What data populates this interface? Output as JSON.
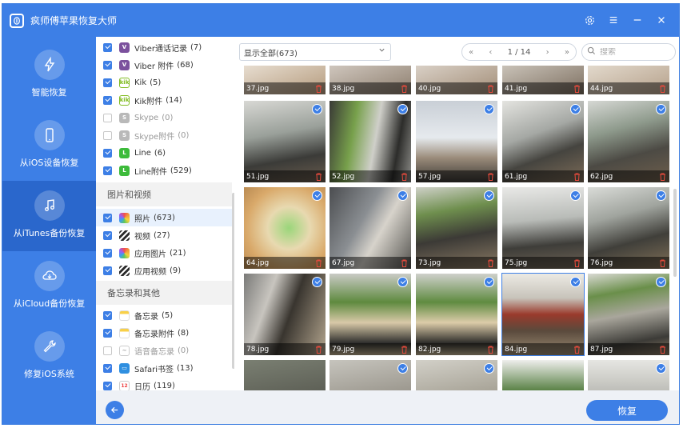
{
  "app": {
    "title": "疯师傅苹果恢复大师"
  },
  "window_controls": [
    "gear-icon",
    "menu-icon",
    "minimize-icon",
    "close-icon"
  ],
  "nav": [
    {
      "label": "智能恢复",
      "icon": "lightning-icon",
      "active": false
    },
    {
      "label": "从iOS设备恢复",
      "icon": "phone-icon",
      "active": false
    },
    {
      "label": "从iTunes备份恢复",
      "icon": "music-note-icon",
      "active": true
    },
    {
      "label": "从iCloud备份恢复",
      "icon": "cloud-icon",
      "active": false
    },
    {
      "label": "修复iOS系统",
      "icon": "wrench-icon",
      "active": false
    }
  ],
  "categories": {
    "messaging": [
      {
        "label": "Viber通话记录",
        "count": "(7)",
        "checked": true,
        "enabled": true,
        "icon": "viber-icon",
        "color": "#7b519d"
      },
      {
        "label": "Viber 附件",
        "count": "(68)",
        "checked": true,
        "enabled": true,
        "icon": "viber-icon",
        "color": "#7b519d"
      },
      {
        "label": "Kik",
        "count": "(5)",
        "checked": true,
        "enabled": true,
        "icon": "kik-icon",
        "color": "#82bc23"
      },
      {
        "label": "Kik附件",
        "count": "(14)",
        "checked": true,
        "enabled": true,
        "icon": "kik-icon",
        "color": "#82bc23"
      },
      {
        "label": "Skype",
        "count": "(0)",
        "checked": false,
        "enabled": false,
        "icon": "skype-icon",
        "color": "#b9b9b9"
      },
      {
        "label": "Skype附件",
        "count": "(0)",
        "checked": false,
        "enabled": false,
        "icon": "skype-icon",
        "color": "#b9b9b9"
      },
      {
        "label": "Line",
        "count": "(6)",
        "checked": true,
        "enabled": true,
        "icon": "line-icon",
        "color": "#3dbb3b"
      },
      {
        "label": "Line附件",
        "count": "(529)",
        "checked": true,
        "enabled": true,
        "icon": "line-icon",
        "color": "#3dbb3b"
      }
    ],
    "media_header": "图片和视频",
    "media": [
      {
        "label": "照片",
        "count": "(673)",
        "checked": true,
        "enabled": true,
        "icon": "photos-icon",
        "color": "#f2a33a",
        "selected": true
      },
      {
        "label": "视频",
        "count": "(27)",
        "checked": true,
        "enabled": true,
        "icon": "clapper-icon",
        "color": "#2a2a2a"
      },
      {
        "label": "应用图片",
        "count": "(21)",
        "checked": true,
        "enabled": true,
        "icon": "photos-icon",
        "color": "#f2a33a"
      },
      {
        "label": "应用视频",
        "count": "(9)",
        "checked": true,
        "enabled": true,
        "icon": "clapper-icon",
        "color": "#2a2a2a"
      }
    ],
    "notes_header": "备忘录和其他",
    "notes": [
      {
        "label": "备忘录",
        "count": "(5)",
        "checked": true,
        "enabled": true,
        "icon": "notes-icon",
        "color": "#f8d048"
      },
      {
        "label": "备忘录附件",
        "count": "(8)",
        "checked": true,
        "enabled": true,
        "icon": "notes-icon",
        "color": "#f8d048"
      },
      {
        "label": "语音备忘录",
        "count": "(0)",
        "checked": false,
        "enabled": false,
        "icon": "voice-memo-icon",
        "color": "#b9b9b9"
      },
      {
        "label": "Safari书签",
        "count": "(13)",
        "checked": true,
        "enabled": true,
        "icon": "safari-icon",
        "color": "#2f8fe0"
      },
      {
        "label": "日历",
        "count": "(119)",
        "checked": true,
        "enabled": true,
        "icon": "calendar-icon",
        "color": "#ffffff"
      }
    ]
  },
  "toolbar": {
    "filter_value": "显示全部(673)",
    "page": "1 / 14",
    "search_placeholder": "搜索"
  },
  "photos": {
    "row0": [
      "37.jpg",
      "38.jpg",
      "40.jpg",
      "41.jpg",
      "44.jpg"
    ],
    "row1": [
      "51.jpg",
      "52.jpg",
      "57.jpg",
      "61.jpg",
      "62.jpg"
    ],
    "row2": [
      "64.jpg",
      "67.jpg",
      "73.jpg",
      "75.jpg",
      "76.jpg"
    ],
    "row3": [
      "78.jpg",
      "79.jpg",
      "82.jpg",
      "84.jpg",
      "87.jpg"
    ]
  },
  "footer": {
    "recover_label": "恢复"
  }
}
